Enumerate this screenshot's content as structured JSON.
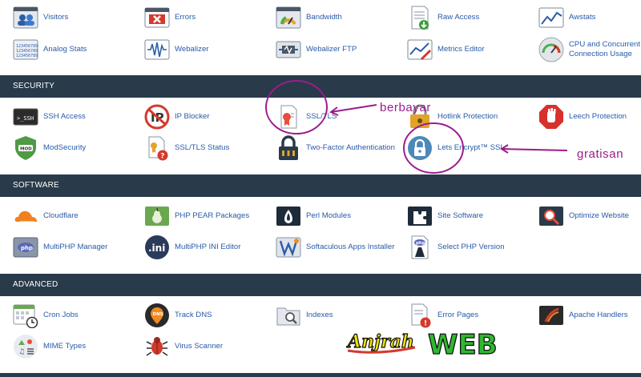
{
  "sections": {
    "metrics_items": [
      {
        "label": "Visitors",
        "icon": "visitors-icon"
      },
      {
        "label": "Errors",
        "icon": "errors-icon"
      },
      {
        "label": "Bandwidth",
        "icon": "bandwidth-icon"
      },
      {
        "label": "Raw Access",
        "icon": "raw-access-icon"
      },
      {
        "label": "Awstats",
        "icon": "awstats-icon"
      },
      {
        "label": "Analog Stats",
        "icon": "analog-stats-icon"
      },
      {
        "label": "Webalizer",
        "icon": "webalizer-icon"
      },
      {
        "label": "Webalizer FTP",
        "icon": "webalizer-ftp-icon"
      },
      {
        "label": "Metrics Editor",
        "icon": "metrics-editor-icon"
      },
      {
        "label": "CPU and Concurrent Connection Usage",
        "icon": "cpu-usage-icon"
      }
    ],
    "security": {
      "title": "SECURITY",
      "items": [
        {
          "label": "SSH Access",
          "icon": "ssh-access-icon"
        },
        {
          "label": "IP Blocker",
          "icon": "ip-blocker-icon"
        },
        {
          "label": "SSL/TLS",
          "icon": "ssl-tls-icon"
        },
        {
          "label": "Hotlink Protection",
          "icon": "hotlink-protection-icon"
        },
        {
          "label": "Leech Protection",
          "icon": "leech-protection-icon"
        },
        {
          "label": "ModSecurity",
          "icon": "modsecurity-icon"
        },
        {
          "label": "SSL/TLS Status",
          "icon": "ssl-tls-status-icon"
        },
        {
          "label": "Two-Factor Authentication",
          "icon": "two-factor-icon"
        },
        {
          "label": "Lets Encrypt™ SSL",
          "icon": "lets-encrypt-icon"
        }
      ]
    },
    "software": {
      "title": "SOFTWARE",
      "items": [
        {
          "label": "Cloudflare",
          "icon": "cloudflare-icon"
        },
        {
          "label": "PHP PEAR Packages",
          "icon": "php-pear-icon"
        },
        {
          "label": "Perl Modules",
          "icon": "perl-modules-icon"
        },
        {
          "label": "Site Software",
          "icon": "site-software-icon"
        },
        {
          "label": "Optimize Website",
          "icon": "optimize-website-icon"
        },
        {
          "label": "MultiPHP Manager",
          "icon": "multiphp-manager-icon"
        },
        {
          "label": "MultiPHP INI Editor",
          "icon": "multiphp-ini-icon"
        },
        {
          "label": "Softaculous Apps Installer",
          "icon": "softaculous-icon"
        },
        {
          "label": "Select PHP Version",
          "icon": "select-php-icon"
        }
      ]
    },
    "advanced": {
      "title": "ADVANCED",
      "items": [
        {
          "label": "Cron Jobs",
          "icon": "cron-jobs-icon"
        },
        {
          "label": "Track DNS",
          "icon": "track-dns-icon"
        },
        {
          "label": "Indexes",
          "icon": "indexes-icon"
        },
        {
          "label": "Error Pages",
          "icon": "error-pages-icon"
        },
        {
          "label": "Apache Handlers",
          "icon": "apache-handlers-icon"
        },
        {
          "label": "MIME Types",
          "icon": "mime-types-icon"
        },
        {
          "label": "Virus Scanner",
          "icon": "virus-scanner-icon"
        }
      ]
    }
  },
  "annotations": {
    "paid": "berbayar",
    "free": "gratisan"
  },
  "watermark": {
    "part1": "Anjrah",
    "part2": "WEB"
  },
  "icon_text": {
    "ssh": ">_SSH",
    "mod": "MOD",
    "php": "php",
    "ini": ".ini",
    "dns": "DNS",
    "analog": "123456789"
  },
  "colors": {
    "header_bg": "#293a4a",
    "link": "#295aa8",
    "annotation": "#9b1c8c"
  }
}
